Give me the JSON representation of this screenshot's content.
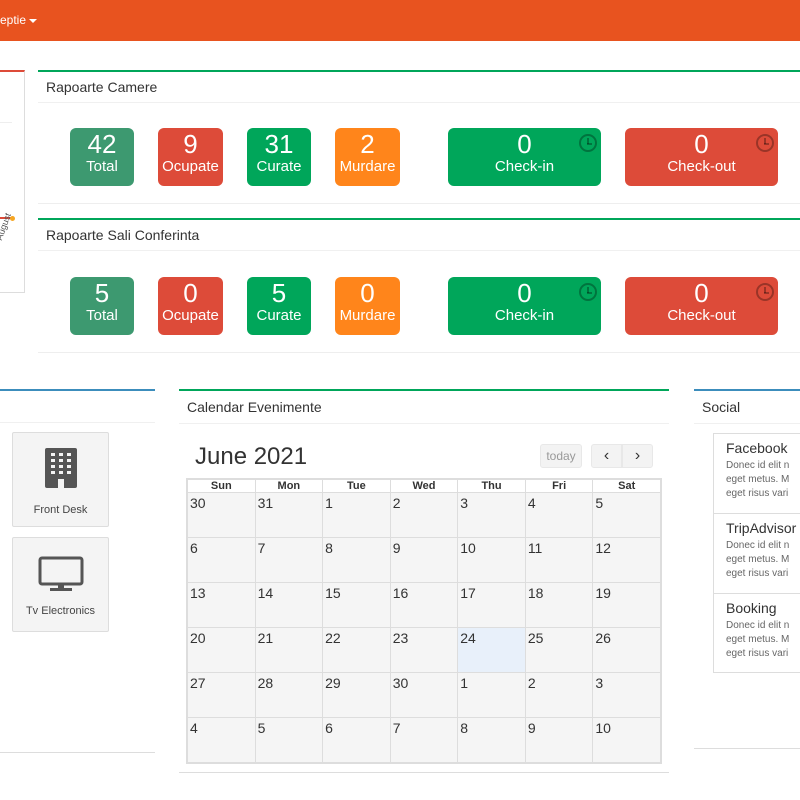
{
  "topbar": {
    "menu_label": "eptie"
  },
  "left_chart": {
    "axis_label": "August"
  },
  "rapoarte_camere": {
    "title": "Rapoarte Camere",
    "total": {
      "value": "42",
      "label": "Total"
    },
    "ocupate": {
      "value": "9",
      "label": "Ocupate"
    },
    "curate": {
      "value": "31",
      "label": "Curate"
    },
    "murdare": {
      "value": "2",
      "label": "Murdare"
    },
    "checkin": {
      "value": "0",
      "label": "Check-in"
    },
    "checkout": {
      "value": "0",
      "label": "Check-out"
    }
  },
  "rapoarte_sali": {
    "title": "Rapoarte Sali Conferinta",
    "total": {
      "value": "5",
      "label": "Total"
    },
    "ocupate": {
      "value": "0",
      "label": "Ocupate"
    },
    "curate": {
      "value": "5",
      "label": "Curate"
    },
    "murdare": {
      "value": "0",
      "label": "Murdare"
    },
    "checkin": {
      "value": "0",
      "label": "Check-in"
    },
    "checkout": {
      "value": "0",
      "label": "Check-out"
    }
  },
  "devices": [
    {
      "label": "Front Desk",
      "icon": "building-icon"
    },
    {
      "label": "Tv Electronics",
      "icon": "monitor-icon"
    }
  ],
  "calendar": {
    "panel_title": "Calendar Evenimente",
    "month_title": "June 2021",
    "today_label": "today",
    "prev_icon": "chevron-left-icon",
    "next_icon": "chevron-right-icon",
    "weekdays": [
      "Sun",
      "Mon",
      "Tue",
      "Wed",
      "Thu",
      "Fri",
      "Sat"
    ],
    "weeks": [
      [
        "30",
        "31",
        "1",
        "2",
        "3",
        "4",
        "5"
      ],
      [
        "6",
        "7",
        "8",
        "9",
        "10",
        "11",
        "12"
      ],
      [
        "13",
        "14",
        "15",
        "16",
        "17",
        "18",
        "19"
      ],
      [
        "20",
        "21",
        "22",
        "23",
        "24",
        "25",
        "26"
      ],
      [
        "27",
        "28",
        "29",
        "30",
        "1",
        "2",
        "3"
      ],
      [
        "4",
        "5",
        "6",
        "7",
        "8",
        "9",
        "10"
      ]
    ]
  },
  "social": {
    "title": "Social",
    "items": [
      {
        "name": "Facebook",
        "lines": [
          "Donec id elit n",
          "eget metus. M",
          "eget risus vari"
        ]
      },
      {
        "name": "TripAdvisor",
        "lines": [
          "Donec id elit n",
          "eget metus. M",
          "eget risus vari"
        ]
      },
      {
        "name": "Booking",
        "lines": [
          "Donec id elit n",
          "eget metus. M",
          "eget risus vari"
        ]
      }
    ]
  },
  "colors": {
    "topbar": "#e8531f",
    "total": "#3d9970",
    "ocupate": "#dd4b39",
    "curate": "#00a65a",
    "murdare": "#ff851b"
  }
}
